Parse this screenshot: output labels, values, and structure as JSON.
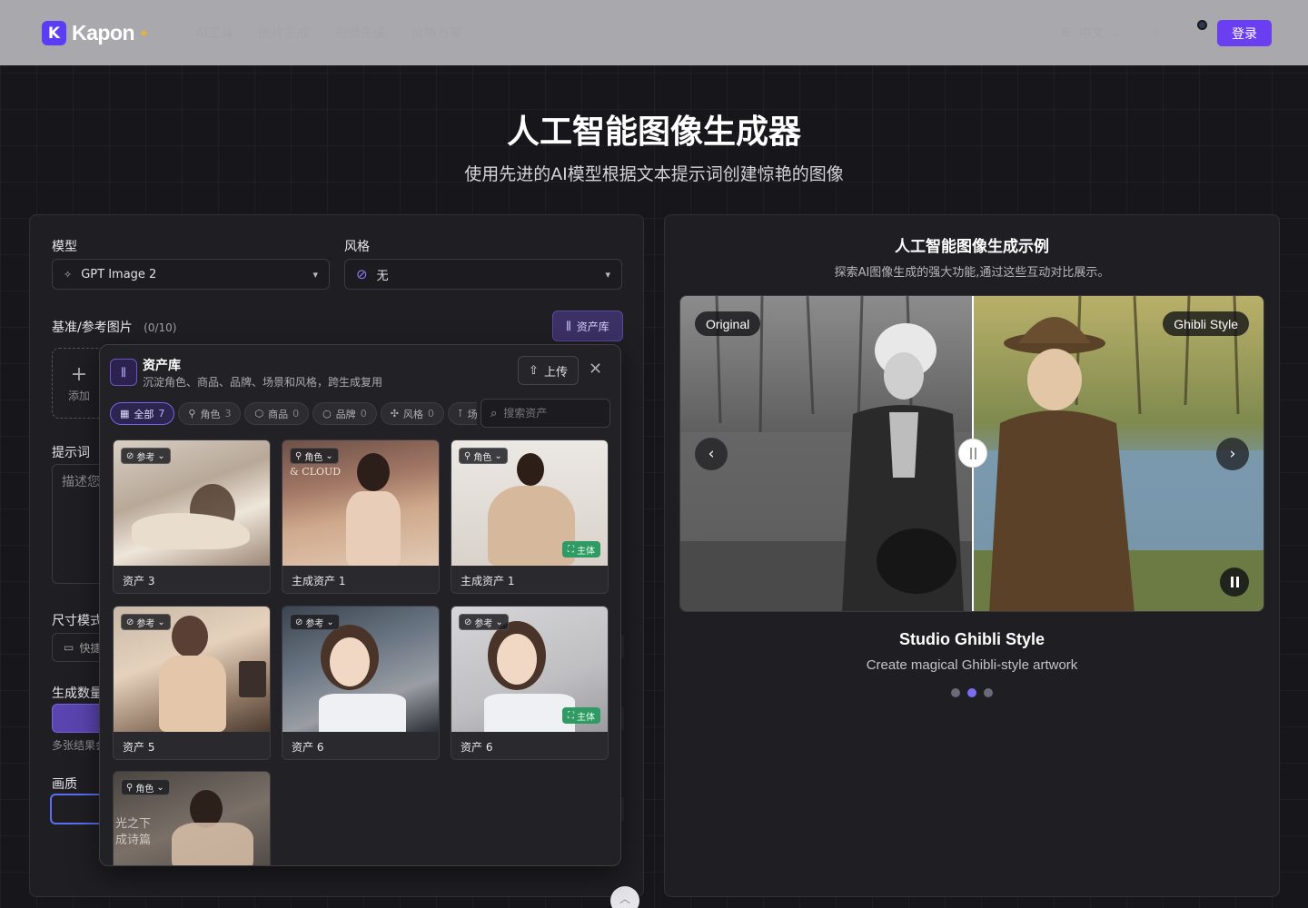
{
  "header": {
    "brand": "Kapon",
    "nav": [
      "AI工具",
      "图片生成",
      "视频生成",
      "价格方案"
    ],
    "language": "中文",
    "login_label": "登录"
  },
  "hero": {
    "title": "人工智能图像生成器",
    "subtitle": "使用先进的AI模型根据文本提示词创建惊艳的图像"
  },
  "form": {
    "model_label": "模型",
    "model_value": "GPT Image 2",
    "style_label": "风格",
    "style_value": "无",
    "reference_label": "基准/参考图片",
    "reference_count": "(0/10)",
    "library_button": "资产库",
    "add_label": "添加",
    "prompt_label": "提示词",
    "prompt_placeholder": "描述您",
    "size_label": "尺寸模式",
    "size_value": "快捷",
    "count_label": "生成数量",
    "count_hint": "多张结果会",
    "quality_label": "画质"
  },
  "asset_library": {
    "title": "资产库",
    "subtitle": "沉淀角色、商品、品牌、场景和风格，跨生成复用",
    "upload_label": "上传",
    "search_placeholder": "搜索资产",
    "filters": [
      {
        "label": "全部",
        "count": "7"
      },
      {
        "label": "角色",
        "count": "3"
      },
      {
        "label": "商品",
        "count": "0"
      },
      {
        "label": "品牌",
        "count": "0"
      },
      {
        "label": "风格",
        "count": "0"
      },
      {
        "label": "场",
        "count": ""
      }
    ],
    "assets": [
      {
        "tag": "参考",
        "name": "资产 3",
        "main": ""
      },
      {
        "tag": "角色",
        "name": "主成资产 1",
        "main": ""
      },
      {
        "tag": "角色",
        "name": "主成资产 1",
        "main": "主体"
      },
      {
        "tag": "参考",
        "name": "资产 5",
        "main": ""
      },
      {
        "tag": "参考",
        "name": "资产 6",
        "main": ""
      },
      {
        "tag": "参考",
        "name": "资产 6",
        "main": "主体"
      },
      {
        "tag": "角色",
        "name": "",
        "main": ""
      }
    ],
    "card_overlay_texts": [
      "& CLOUD",
      "光之下",
      "成诗篇"
    ]
  },
  "showcase": {
    "title": "人工智能图像生成示例",
    "subtitle": "探索AI图像生成的强大功能,通过这些互动对比展示。",
    "before_label": "Original",
    "after_label": "Ghibli Style",
    "style_title": "Studio Ghibli Style",
    "style_desc": "Create magical Ghibli-style artwork",
    "slide_count": 3,
    "active_slide": 2
  },
  "colors": {
    "accent": "#6a3ff0",
    "main_tag": "#2f9a64"
  }
}
